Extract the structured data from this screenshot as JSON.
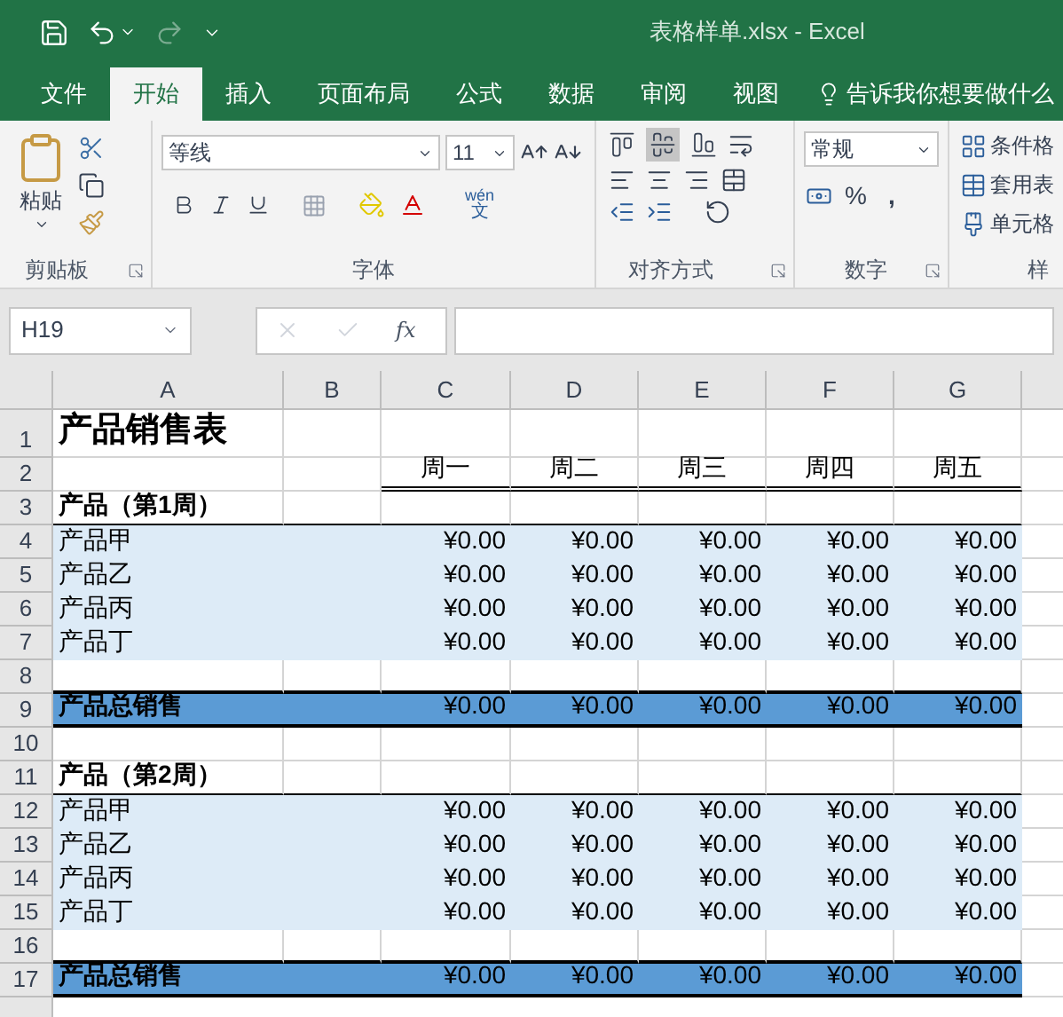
{
  "window": {
    "title": "表格样单.xlsx - Excel"
  },
  "quick_access": {
    "redo_disabled": true
  },
  "tabs": [
    {
      "label": "文件",
      "selected": false
    },
    {
      "label": "开始",
      "selected": true
    },
    {
      "label": "插入",
      "selected": false
    },
    {
      "label": "页面布局",
      "selected": false
    },
    {
      "label": "公式",
      "selected": false
    },
    {
      "label": "数据",
      "selected": false
    },
    {
      "label": "审阅",
      "selected": false
    },
    {
      "label": "视图",
      "selected": false
    }
  ],
  "tell_me": "告诉我你想要做什么",
  "clipboard": {
    "paste": "粘贴",
    "label": "剪贴板"
  },
  "font": {
    "font_name": "等线",
    "font_size": "11",
    "phonetic_top": "wén",
    "phonetic_bottom": "文",
    "label": "字体"
  },
  "alignment": {
    "label": "对齐方式",
    "vertical_align": [
      {
        "selected": false
      },
      {
        "selected": true
      },
      {
        "selected": false
      }
    ]
  },
  "number": {
    "format": "常规",
    "percent": "%",
    "comma": ",",
    "label": "数字"
  },
  "styles": {
    "items": [
      "条件格",
      "套用表",
      "单元格"
    ],
    "label": "样"
  },
  "formula_bar": {
    "name_box": "H19",
    "function_label": "fx"
  },
  "columns": [
    "A",
    "B",
    "C",
    "D",
    "E",
    "F",
    "G"
  ],
  "rows": [
    {
      "num": "1",
      "kind": "title",
      "label": "产品销售表"
    },
    {
      "num": "2",
      "kind": "days",
      "values": [
        "周一",
        "周二",
        "周三",
        "周四",
        "周五"
      ]
    },
    {
      "num": "3",
      "kind": "section",
      "label": "产品（第1周）"
    },
    {
      "num": "4",
      "kind": "item",
      "label": "产品甲",
      "values": [
        "¥0.00",
        "¥0.00",
        "¥0.00",
        "¥0.00",
        "¥0.00"
      ]
    },
    {
      "num": "5",
      "kind": "item",
      "label": "产品乙",
      "values": [
        "¥0.00",
        "¥0.00",
        "¥0.00",
        "¥0.00",
        "¥0.00"
      ]
    },
    {
      "num": "6",
      "kind": "item",
      "label": "产品丙",
      "values": [
        "¥0.00",
        "¥0.00",
        "¥0.00",
        "¥0.00",
        "¥0.00"
      ]
    },
    {
      "num": "7",
      "kind": "item",
      "label": "产品丁",
      "values": [
        "¥0.00",
        "¥0.00",
        "¥0.00",
        "¥0.00",
        "¥0.00"
      ]
    },
    {
      "num": "8",
      "kind": "blank"
    },
    {
      "num": "9",
      "kind": "total",
      "label": "产品总销售",
      "values": [
        "¥0.00",
        "¥0.00",
        "¥0.00",
        "¥0.00",
        "¥0.00"
      ]
    },
    {
      "num": "10",
      "kind": "blank"
    },
    {
      "num": "11",
      "kind": "section",
      "label": "产品（第2周）"
    },
    {
      "num": "12",
      "kind": "item",
      "label": "产品甲",
      "values": [
        "¥0.00",
        "¥0.00",
        "¥0.00",
        "¥0.00",
        "¥0.00"
      ]
    },
    {
      "num": "13",
      "kind": "item",
      "label": "产品乙",
      "values": [
        "¥0.00",
        "¥0.00",
        "¥0.00",
        "¥0.00",
        "¥0.00"
      ]
    },
    {
      "num": "14",
      "kind": "item",
      "label": "产品丙",
      "values": [
        "¥0.00",
        "¥0.00",
        "¥0.00",
        "¥0.00",
        "¥0.00"
      ]
    },
    {
      "num": "15",
      "kind": "item",
      "label": "产品丁",
      "values": [
        "¥0.00",
        "¥0.00",
        "¥0.00",
        "¥0.00",
        "¥0.00"
      ]
    },
    {
      "num": "16",
      "kind": "blank"
    },
    {
      "num": "17",
      "kind": "total",
      "label": "产品总销售",
      "values": [
        "¥0.00",
        "¥0.00",
        "¥0.00",
        "¥0.00",
        "¥0.00"
      ]
    }
  ]
}
